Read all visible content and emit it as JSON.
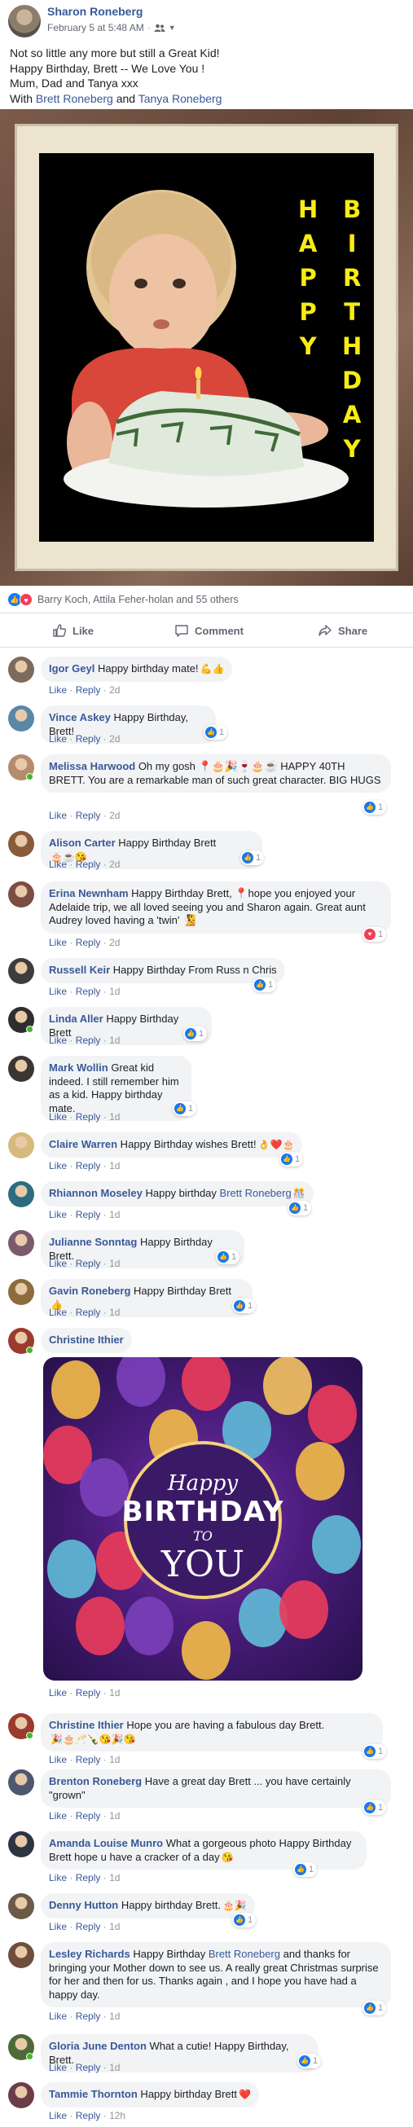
{
  "post": {
    "author": "Sharon Roneberg",
    "date": "February 5 at 5:48 AM",
    "audience_icon": "friends-icon",
    "lines": [
      "Not so little any more but still a Great Kid!",
      "Happy Birthday, Brett -- We Love You !",
      "Mum, Dad and Tanya xxx"
    ],
    "with_prefix": "With",
    "with_tag_1": "Brett Roneberg",
    "with_and": "and",
    "with_tag_2": "Tanya Roneberg"
  },
  "photo": {
    "col1": [
      "H",
      "A",
      "P",
      "P",
      "Y"
    ],
    "col2": [
      "B",
      "I",
      "R",
      "T",
      "H",
      "D",
      "A",
      "Y"
    ],
    "text_color": "#f7ec12"
  },
  "reactions": {
    "summary": "Barry Koch, Attila Feher-holan and 55 others"
  },
  "actions": {
    "like": "Like",
    "comment": "Comment",
    "share": "Share"
  },
  "meta_labels": {
    "like": "Like",
    "reply": "Reply",
    "sep": "·"
  },
  "comments": [
    {
      "name": "Igor Geyl",
      "text": " Happy birthday mate!",
      "emoji": "💪👍",
      "time": "2d",
      "react": ""
    },
    {
      "name": "Vince Askey",
      "text": " Happy Birthday, Brett!",
      "emoji": "",
      "time": "2d",
      "react": "1"
    },
    {
      "name": "Melissa Harwood",
      "text": " Oh my gosh 📍🎂🎉🍷🎂☕ HAPPY 40TH BRETT. You are a remarkable man of such great character. BIG HUGS",
      "emoji": "",
      "time": "2d",
      "react": "1"
    },
    {
      "name": "Alison Carter",
      "text": " Happy Birthday Brett",
      "emoji": "🎂☕😘",
      "time": "2d",
      "react": "1"
    },
    {
      "name": "Erina Newnham",
      "text": " Happy Birthday Brett, 📍hope you enjoyed your Adelaide trip, we all loved seeing you and Sharon again. Great aunt Audrey loved having a 'twin' 🧏",
      "emoji": "",
      "time": "2d",
      "react": "1"
    },
    {
      "name": "Russell Keir",
      "text": " Happy Birthday From Russ n Chris",
      "emoji": "",
      "time": "1d",
      "react": "1"
    },
    {
      "name": "Linda Aller",
      "text": " Happy Birthday Brett",
      "emoji": "",
      "time": "1d",
      "react": "1"
    },
    {
      "name": "Mark Wollin",
      "text": " Great kid indeed. I still remember him as a kid. Happy birthday mate.",
      "emoji": "",
      "time": "1d",
      "react": "1"
    },
    {
      "name": "Claire Warren",
      "text": " Happy Birthday wishes Brett!",
      "emoji": "👌❤️🎂",
      "time": "1d",
      "react": "1"
    },
    {
      "name": "Rhiannon Moseley",
      "text": " Happy birthday ",
      "tag": "Brett Roneberg",
      "emoji": "🎊",
      "time": "1d",
      "react": "1"
    },
    {
      "name": "Julianne Sonntag",
      "text": " Happy Birthday Brett.",
      "emoji": "",
      "time": "1d",
      "react": "1"
    },
    {
      "name": "Gavin Roneberg",
      "text": " Happy Birthday Brett",
      "emoji": "👍",
      "time": "1d",
      "react": "1"
    },
    {
      "name": "Christine Ithier",
      "text": "",
      "emoji": "",
      "time": "1d",
      "react": ""
    },
    {
      "name": "Christine Ithier",
      "text": " Hope you are having a fabulous day Brett.",
      "emoji": "🎉🎂🥂🍾😘🎉😘",
      "time": "1d",
      "react": "1"
    },
    {
      "name": "Brenton Roneberg",
      "text": " Have a great day Brett ... you have certainly \"grown\"",
      "emoji": "",
      "time": "1d",
      "react": "1"
    },
    {
      "name": "Amanda Louise Munro",
      "text": " What a gorgeous photo Happy Birthday Brett hope u have a cracker of a day",
      "emoji": "😘",
      "time": "1d",
      "react": "1"
    },
    {
      "name": "Denny Hutton",
      "text": " Happy birthday Brett.",
      "emoji": "🎂🎉",
      "time": "1d",
      "react": "1"
    },
    {
      "name": "Lesley Richards",
      "text": " Happy Birthday ",
      "tag": "Brett Roneberg",
      "text2": " and thanks for bringing your Mother down to see us. A really great Christmas surprise for her and then for us. Thanks again , and I hope you have had a happy day.",
      "emoji": "",
      "time": "1d",
      "react": "1"
    },
    {
      "name": "Gloria June Denton",
      "text": " What a cutie! Happy Birthday, Brett.",
      "emoji": "",
      "time": "1d",
      "react": "1"
    },
    {
      "name": "Tammie Thornton",
      "text": " Happy birthday Brett",
      "emoji": "❤️",
      "time": "12h",
      "react": ""
    }
  ],
  "gif": {
    "happy": "Happy",
    "birthday": "BIRTHDAY",
    "to": "TO",
    "you": "YOU"
  }
}
